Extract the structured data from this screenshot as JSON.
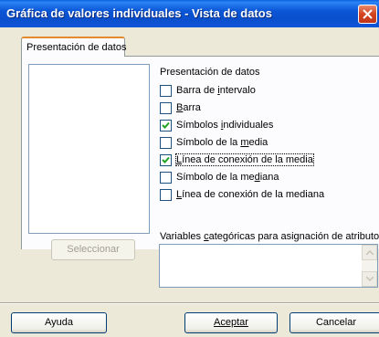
{
  "window": {
    "title": "Gráfica de valores individuales - Vista de datos"
  },
  "tab": {
    "label": "Presentación de datos"
  },
  "buttons": {
    "select": "Seleccionar",
    "help": "Ayuda",
    "accept": "Aceptar",
    "cancel": "Cancelar"
  },
  "display": {
    "group_label": "Presentación de datos",
    "options": [
      {
        "pre": "Barra de ",
        "u": "i",
        "post": "ntervalo",
        "checked": false
      },
      {
        "pre": "",
        "u": "B",
        "post": "arra",
        "checked": false
      },
      {
        "pre": "Símbolos ",
        "u": "i",
        "post": "ndividuales",
        "checked": true
      },
      {
        "pre": "Símbolo de la ",
        "u": "m",
        "post": "edia",
        "checked": false
      },
      {
        "pre": "",
        "u": "L",
        "post": "ínea de conexión de la media",
        "checked": true
      },
      {
        "pre": "Símbolo de la me",
        "u": "d",
        "post": "iana",
        "checked": false
      },
      {
        "pre": "",
        "u": "L",
        "post": "ínea de conexión de la mediana",
        "checked": false
      }
    ]
  },
  "variables": {
    "label_pre": "Variables ",
    "label_u": "c",
    "label_post": "ategóricas para asignación de atributos:",
    "value": ""
  }
}
